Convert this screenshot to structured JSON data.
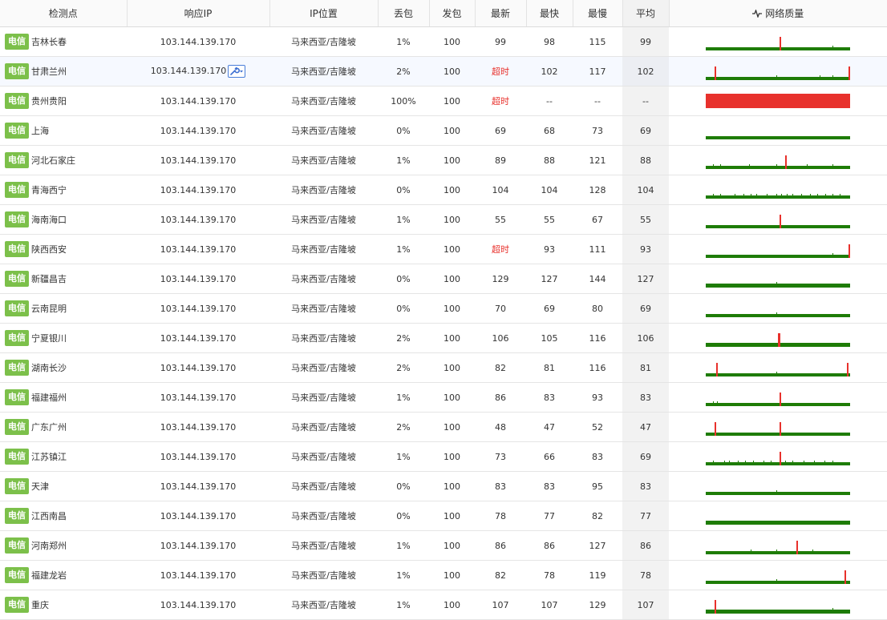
{
  "columns": {
    "node": "检测点",
    "ip": "响应IP",
    "location": "IP位置",
    "loss": "丢包",
    "sent": "发包",
    "latest": "最新",
    "fastest": "最快",
    "slowest": "最慢",
    "avg": "平均",
    "quality": "网络质量",
    "quality_icon": "pulse-icon"
  },
  "colors": {
    "isp_badge": "#7cc04a",
    "spark_ok": "#1e7c06",
    "spark_bad": "#e8312c",
    "timeout_text": "#e8312c"
  },
  "rows": [
    {
      "isp": "电信",
      "node": "吉林长春",
      "ip": "103.144.139.170",
      "location": "马来西亚/吉隆坡",
      "loss": "1%",
      "sent": "100",
      "latest": "99",
      "fastest": "98",
      "slowest": "115",
      "avg": "99",
      "spikes": [
        {
          "pos": 0.51,
          "h": 17
        }
      ],
      "specks": [
        0.88
      ]
    },
    {
      "isp": "电信",
      "node": "甘肃兰州",
      "ip": "103.144.139.170",
      "location": "马来西亚/吉隆坡",
      "loss": "2%",
      "sent": "100",
      "latest": "超时",
      "fastest": "102",
      "slowest": "117",
      "avg": "102",
      "spikes": [
        {
          "pos": 0.06,
          "h": 17
        },
        {
          "pos": 0.99,
          "h": 17
        }
      ],
      "specks": [
        0.49,
        0.79,
        0.88
      ],
      "tool_icon": "wrench-icon"
    },
    {
      "isp": "电信",
      "node": "贵州贵阳",
      "ip": "103.144.139.170",
      "location": "马来西亚/吉隆坡",
      "loss": "100%",
      "sent": "100",
      "latest": "超时",
      "fastest": "--",
      "slowest": "--",
      "avg": "--",
      "full_loss": true
    },
    {
      "isp": "电信",
      "node": "上海",
      "ip": "103.144.139.170",
      "location": "马来西亚/吉隆坡",
      "loss": "0%",
      "sent": "100",
      "latest": "69",
      "fastest": "68",
      "slowest": "73",
      "avg": "69"
    },
    {
      "isp": "电信",
      "node": "河北石家庄",
      "ip": "103.144.139.170",
      "location": "马来西亚/吉隆坡",
      "loss": "1%",
      "sent": "100",
      "latest": "89",
      "fastest": "88",
      "slowest": "121",
      "avg": "88",
      "spikes": [
        {
          "pos": 0.55,
          "h": 17
        }
      ],
      "specks": [
        0.05,
        0.1,
        0.3,
        0.49,
        0.7,
        0.88
      ]
    },
    {
      "isp": "电信",
      "node": "青海西宁",
      "ip": "103.144.139.170",
      "location": "马来西亚/吉隆坡",
      "loss": "0%",
      "sent": "100",
      "latest": "104",
      "fastest": "104",
      "slowest": "128",
      "avg": "104",
      "specks": [
        0.05,
        0.1,
        0.2,
        0.26,
        0.31,
        0.35,
        0.42,
        0.49,
        0.52,
        0.56,
        0.6,
        0.66,
        0.72,
        0.77,
        0.83,
        0.88,
        0.93
      ]
    },
    {
      "isp": "电信",
      "node": "海南海口",
      "ip": "103.144.139.170",
      "location": "马来西亚/吉隆坡",
      "loss": "1%",
      "sent": "100",
      "latest": "55",
      "fastest": "55",
      "slowest": "67",
      "avg": "55",
      "spikes": [
        {
          "pos": 0.51,
          "h": 17
        }
      ]
    },
    {
      "isp": "电信",
      "node": "陕西西安",
      "ip": "103.144.139.170",
      "location": "马来西亚/吉隆坡",
      "loss": "1%",
      "sent": "100",
      "latest": "超时",
      "fastest": "93",
      "slowest": "111",
      "avg": "93",
      "spikes": [
        {
          "pos": 0.99,
          "h": 17
        }
      ],
      "specks": [
        0.88
      ]
    },
    {
      "isp": "电信",
      "node": "新疆昌吉",
      "ip": "103.144.139.170",
      "location": "马来西亚/吉隆坡",
      "loss": "0%",
      "sent": "100",
      "latest": "129",
      "fastest": "127",
      "slowest": "144",
      "avg": "127",
      "thick": true,
      "specks": [
        0.49
      ]
    },
    {
      "isp": "电信",
      "node": "云南昆明",
      "ip": "103.144.139.170",
      "location": "马来西亚/吉隆坡",
      "loss": "0%",
      "sent": "100",
      "latest": "70",
      "fastest": "69",
      "slowest": "80",
      "avg": "69",
      "specks": [
        0.49
      ]
    },
    {
      "isp": "电信",
      "node": "宁夏银川",
      "ip": "103.144.139.170",
      "location": "马来西亚/吉隆坡",
      "loss": "2%",
      "sent": "100",
      "latest": "106",
      "fastest": "105",
      "slowest": "116",
      "avg": "106",
      "thick": true,
      "spikes": [
        {
          "pos": 0.5,
          "h": 17,
          "w": 3
        }
      ]
    },
    {
      "isp": "电信",
      "node": "湖南长沙",
      "ip": "103.144.139.170",
      "location": "马来西亚/吉隆坡",
      "loss": "2%",
      "sent": "100",
      "latest": "82",
      "fastest": "81",
      "slowest": "116",
      "avg": "81",
      "spikes": [
        {
          "pos": 0.07,
          "h": 17
        },
        {
          "pos": 0.98,
          "h": 17
        }
      ],
      "specks": [
        0.49
      ]
    },
    {
      "isp": "电信",
      "node": "福建福州",
      "ip": "103.144.139.170",
      "location": "马来西亚/吉隆坡",
      "loss": "1%",
      "sent": "100",
      "latest": "86",
      "fastest": "83",
      "slowest": "93",
      "avg": "83",
      "spikes": [
        {
          "pos": 0.51,
          "h": 17
        }
      ],
      "specks": [
        0.05,
        0.08
      ]
    },
    {
      "isp": "电信",
      "node": "广东广州",
      "ip": "103.144.139.170",
      "location": "马来西亚/吉隆坡",
      "loss": "2%",
      "sent": "100",
      "latest": "48",
      "fastest": "47",
      "slowest": "52",
      "avg": "47",
      "spikes": [
        {
          "pos": 0.06,
          "h": 17
        },
        {
          "pos": 0.51,
          "h": 17
        }
      ]
    },
    {
      "isp": "电信",
      "node": "江苏镇江",
      "ip": "103.144.139.170",
      "location": "马来西亚/吉隆坡",
      "loss": "1%",
      "sent": "100",
      "latest": "73",
      "fastest": "66",
      "slowest": "83",
      "avg": "69",
      "spikes": [
        {
          "pos": 0.51,
          "h": 17
        }
      ],
      "specks": [
        0.05,
        0.13,
        0.16,
        0.22,
        0.27,
        0.33,
        0.4,
        0.45,
        0.55,
        0.6,
        0.68,
        0.75,
        0.82,
        0.88
      ]
    },
    {
      "isp": "电信",
      "node": "天津",
      "ip": "103.144.139.170",
      "location": "马来西亚/吉隆坡",
      "loss": "0%",
      "sent": "100",
      "latest": "83",
      "fastest": "83",
      "slowest": "95",
      "avg": "83",
      "specks": [
        0.49
      ]
    },
    {
      "isp": "电信",
      "node": "江西南昌",
      "ip": "103.144.139.170",
      "location": "马来西亚/吉隆坡",
      "loss": "0%",
      "sent": "100",
      "latest": "78",
      "fastest": "77",
      "slowest": "82",
      "avg": "77",
      "thick": true
    },
    {
      "isp": "电信",
      "node": "河南郑州",
      "ip": "103.144.139.170",
      "location": "马来西亚/吉隆坡",
      "loss": "1%",
      "sent": "100",
      "latest": "86",
      "fastest": "86",
      "slowest": "127",
      "avg": "86",
      "spikes": [
        {
          "pos": 0.63,
          "h": 17
        }
      ],
      "specks": [
        0.31,
        0.49,
        0.74
      ]
    },
    {
      "isp": "电信",
      "node": "福建龙岩",
      "ip": "103.144.139.170",
      "location": "马来西亚/吉隆坡",
      "loss": "1%",
      "sent": "100",
      "latest": "82",
      "fastest": "78",
      "slowest": "119",
      "avg": "78",
      "spikes": [
        {
          "pos": 0.96,
          "h": 17
        }
      ],
      "specks": [
        0.49
      ]
    },
    {
      "isp": "电信",
      "node": "重庆",
      "ip": "103.144.139.170",
      "location": "马来西亚/吉隆坡",
      "loss": "1%",
      "sent": "100",
      "latest": "107",
      "fastest": "107",
      "slowest": "129",
      "avg": "107",
      "thick": true,
      "spikes": [
        {
          "pos": 0.06,
          "h": 17
        }
      ],
      "specks": [
        0.88
      ]
    }
  ]
}
